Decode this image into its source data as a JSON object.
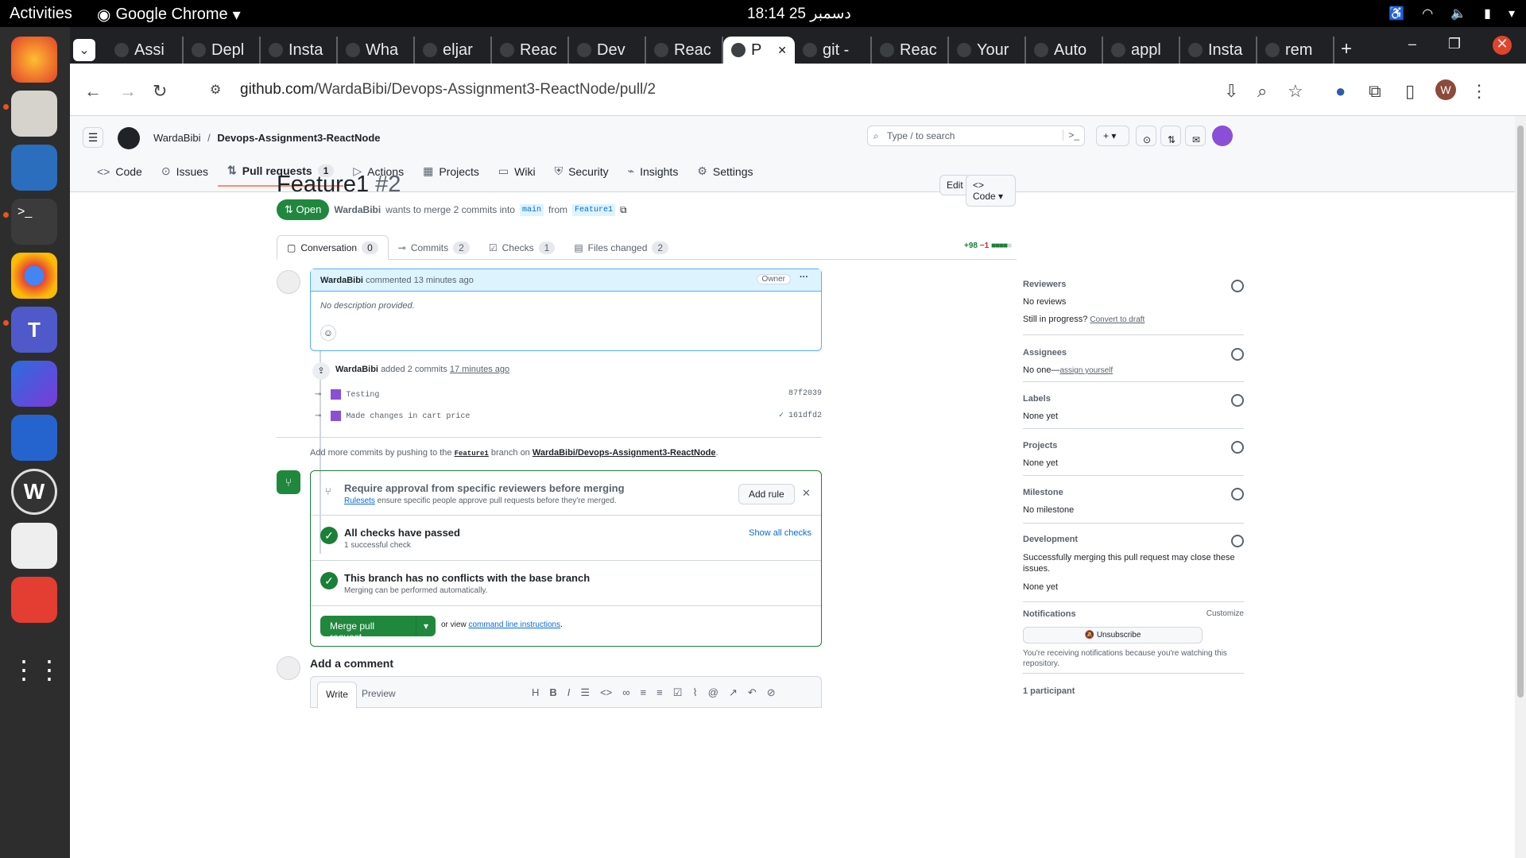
{
  "system": {
    "activities": "Activities",
    "app_name": "Google Chrome",
    "clock": "18:14  25 دسمبر"
  },
  "browser": {
    "tabs": [
      "Assi",
      "Depl",
      "Insta",
      "Wha",
      "eljar",
      "Reac",
      "Dev",
      "Reac",
      "P",
      "git -",
      "Reac",
      "Your",
      "Auto",
      "appl",
      "Insta",
      "rem"
    ],
    "url_host": "github.com",
    "url_path": "/WardaBibi/Devops-Assignment3-ReactNode/pull/2",
    "profile_initial": "W"
  },
  "repo": {
    "owner": "WardaBibi",
    "name": "Devops-Assignment3-ReactNode",
    "search_placeholder": "Type / to search",
    "tabs": [
      {
        "label": "Code"
      },
      {
        "label": "Issues"
      },
      {
        "label": "Pull requests",
        "count": "1"
      },
      {
        "label": "Actions"
      },
      {
        "label": "Projects"
      },
      {
        "label": "Wiki"
      },
      {
        "label": "Security"
      },
      {
        "label": "Insights"
      },
      {
        "label": "Settings"
      }
    ]
  },
  "pr": {
    "title": "Feature1",
    "number": "#2",
    "state": "Open",
    "author": "WardaBibi",
    "merge_text": "wants to merge 2 commits into",
    "base": "main",
    "from": "from",
    "head": "Feature1",
    "edit": "Edit",
    "code": "Code",
    "tabs": [
      {
        "label": "Conversation",
        "count": "0"
      },
      {
        "label": "Commits",
        "count": "2"
      },
      {
        "label": "Checks",
        "count": "1"
      },
      {
        "label": "Files changed",
        "count": "2"
      }
    ],
    "additions": "+98",
    "deletions": "−1"
  },
  "comment": {
    "author": "WardaBibi",
    "meta": "commented 13 minutes ago",
    "badge": "Owner",
    "body": "No description provided."
  },
  "timeline": {
    "author": "WardaBibi",
    "text": "added 2 commits",
    "time": "17 minutes ago",
    "commits": [
      {
        "msg": "Testing",
        "sha": "87f2039"
      },
      {
        "msg": "Made changes in cart price",
        "sha": "161dfd2"
      }
    ],
    "hint_prefix": "Add more commits by pushing to the",
    "hint_branch": "Feature1",
    "hint_mid": "branch on",
    "hint_repo": "WardaBibi/Devops-Assignment3-ReactNode",
    "hint_end": "."
  },
  "merge": {
    "rule_title": "Require approval from specific reviewers before merging",
    "rule_link": "Rulesets",
    "rule_desc": "ensure specific people approve pull requests before they're merged.",
    "add_rule": "Add rule",
    "checks_title": "All checks have passed",
    "checks_sub": "1 successful check",
    "show_checks": "Show all checks",
    "conflict_title": "This branch has no conflicts with the base branch",
    "conflict_sub": "Merging can be performed automatically.",
    "merge_btn": "Merge pull request",
    "or_view": "or view",
    "cli_link": "command line instructions",
    "cli_end": "."
  },
  "add_comment": {
    "title": "Add a comment",
    "write": "Write",
    "preview": "Preview"
  },
  "sidebar": {
    "reviewers": {
      "label": "Reviewers",
      "value": "No reviews",
      "draft_q": "Still in progress?",
      "draft_link": "Convert to draft"
    },
    "assignees": {
      "label": "Assignees",
      "value": "No one—",
      "link": "assign yourself"
    },
    "labels": {
      "label": "Labels",
      "value": "None yet"
    },
    "projects": {
      "label": "Projects",
      "value": "None yet"
    },
    "milestone": {
      "label": "Milestone",
      "value": "No milestone"
    },
    "development": {
      "label": "Development",
      "desc": "Successfully merging this pull request may close these issues.",
      "value": "None yet"
    },
    "notifications": {
      "label": "Notifications",
      "customize": "Customize",
      "btn": "Unsubscribe",
      "desc": "You're receiving notifications because you're watching this repository."
    },
    "participants": "1 participant"
  }
}
